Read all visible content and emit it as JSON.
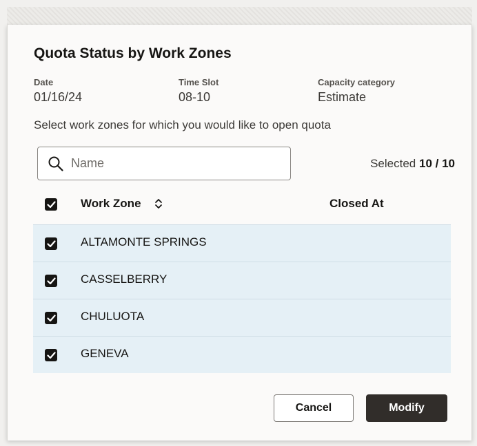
{
  "dialog": {
    "title": "Quota Status by Work Zones",
    "meta": [
      {
        "label": "Date",
        "value": "01/16/24"
      },
      {
        "label": "Time Slot",
        "value": "08-10"
      },
      {
        "label": "Capacity category",
        "value": "Estimate"
      }
    ],
    "instruction": "Select work zones for which you would like to open quota",
    "search": {
      "placeholder": "Name",
      "value": ""
    },
    "selected": {
      "prefix": "Selected",
      "count": "10 / 10"
    },
    "table": {
      "columns": [
        "Work Zone",
        "Closed At"
      ],
      "rows": [
        {
          "zone": "ALTAMONTE SPRINGS",
          "closed_at": "",
          "checked": true
        },
        {
          "zone": "CASSELBERRY",
          "closed_at": "",
          "checked": true
        },
        {
          "zone": "CHULUOTA",
          "closed_at": "",
          "checked": true
        },
        {
          "zone": "GENEVA",
          "closed_at": "",
          "checked": true
        }
      ]
    },
    "buttons": {
      "cancel": "Cancel",
      "modify": "Modify"
    }
  },
  "icons": {
    "search": "search-icon",
    "sort": "sort-icon",
    "checkbox": "checkmark-icon"
  },
  "colors": {
    "primary_button": "#312d2a",
    "row_highlight": "#e5f0f6",
    "checkbox": "#161513"
  }
}
